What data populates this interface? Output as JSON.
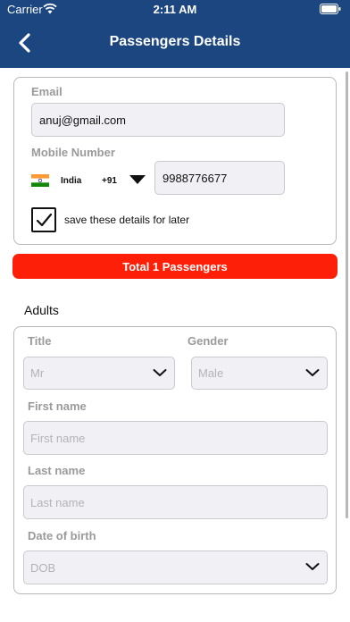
{
  "status_bar": {
    "carrier": "Carrier",
    "time": "2:11 AM"
  },
  "nav": {
    "title": "Passengers Details"
  },
  "contact": {
    "email_label": "Email",
    "email_value": "anuj@gmail.com",
    "mobile_label": "Mobile Number",
    "country_name": "India",
    "country_code": "+91",
    "mobile_value": "9988776677",
    "save_details_label": "save these details for later",
    "save_details_checked": true
  },
  "total_button": {
    "label": "Total 1 Passengers"
  },
  "adults": {
    "heading": "Adults",
    "title_label": "Title",
    "title_value": "Mr",
    "gender_label": "Gender",
    "gender_value": "Male",
    "first_name_label": "First name",
    "first_name_placeholder": "First name",
    "last_name_label": "Last name",
    "last_name_placeholder": "Last name",
    "dob_label": "Date of birth",
    "dob_placeholder": "DOB"
  },
  "colors": {
    "nav_bg": "#1b4680",
    "total_bg": "#fd1f07",
    "field_bg": "#f1f1f5"
  }
}
